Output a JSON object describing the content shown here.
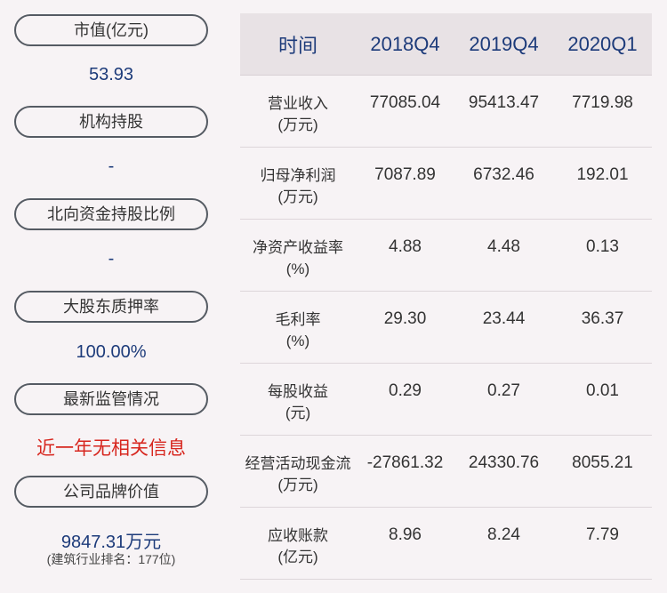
{
  "left_panel": {
    "items": [
      {
        "label": "市值(亿元)",
        "value": "53.93"
      },
      {
        "label": "机构持股",
        "value": "-"
      },
      {
        "label": "北向资金持股比例",
        "value": "-"
      },
      {
        "label": "大股东质押率",
        "value": "100.00%"
      },
      {
        "label": "最新监管情况",
        "value": "近一年无相关信息"
      },
      {
        "label": "公司品牌价值",
        "value": "9847.31万元",
        "sub": "(建筑行业排名：177位)"
      }
    ]
  },
  "table": {
    "headers": [
      "时间",
      "2018Q4",
      "2019Q4",
      "2020Q1"
    ],
    "rows": [
      {
        "label1": "营业收入",
        "label2": "(万元)",
        "values": [
          "77085.04",
          "95413.47",
          "7719.98"
        ]
      },
      {
        "label1": "归母净利润",
        "label2": "(万元)",
        "values": [
          "7087.89",
          "6732.46",
          "192.01"
        ]
      },
      {
        "label1": "净资产收益率",
        "label2": "(%)",
        "values": [
          "4.88",
          "4.48",
          "0.13"
        ]
      },
      {
        "label1": "毛利率",
        "label2": "(%)",
        "values": [
          "29.30",
          "23.44",
          "36.37"
        ]
      },
      {
        "label1": "每股收益",
        "label2": "(元)",
        "values": [
          "0.29",
          "0.27",
          "0.01"
        ]
      },
      {
        "label1": "经营活动现金流",
        "label2": "(万元)",
        "values": [
          "-27861.32",
          "24330.76",
          "8055.21"
        ]
      },
      {
        "label1": "应收账款",
        "label2": "(亿元)",
        "values": [
          "8.96",
          "8.24",
          "7.79"
        ]
      }
    ]
  }
}
